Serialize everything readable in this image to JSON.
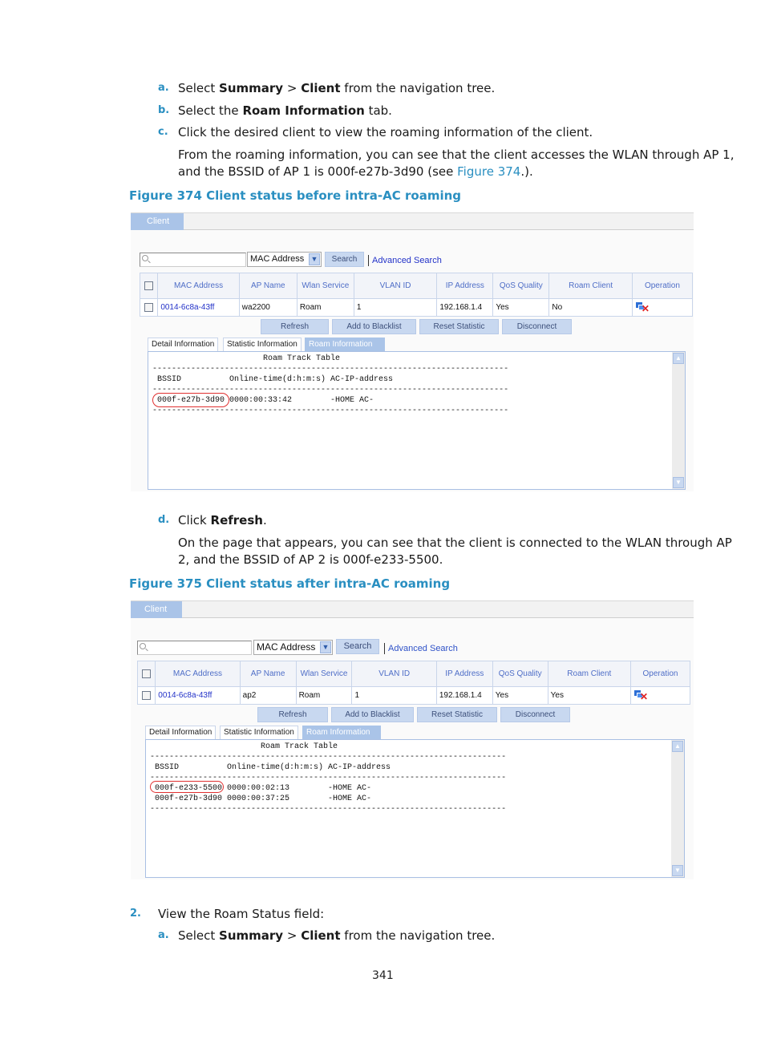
{
  "steps_top": [
    {
      "marker": "a.",
      "pre": "Select ",
      "b1": "Summary",
      "mid": " > ",
      "b2": "Client",
      "post": " from the navigation tree."
    },
    {
      "marker": "b.",
      "pre": "Select the ",
      "b1": "Roam Information",
      "post": " tab."
    },
    {
      "marker": "c.",
      "text": "Click the desired client to view the roaming information of the client."
    }
  ],
  "para1": {
    "line1": "From the roaming information, you can see that the client accesses the WLAN through AP 1,",
    "line2_pre": "and the BSSID of AP 1 is 000f-e27b-3d90 (see ",
    "line2_link": "Figure 374",
    "line2_post": ".)."
  },
  "figure374": {
    "caption": "Figure 374 Client status before intra-AC roaming",
    "tab_label": "Client",
    "search_placeholder": "",
    "select_value": "MAC Address",
    "search_button": "Search",
    "advanced_search": "Advanced Search",
    "columns": [
      "MAC Address",
      "AP Name",
      "Wlan Service",
      "VLAN ID",
      "IP Address",
      "QoS Quality",
      "Roam Client",
      "Operation"
    ],
    "row": {
      "mac": "0014-6c8a-43ff",
      "ap_name": "wa2200",
      "wlan_service": "Roam",
      "vlan_id": "1",
      "ip": "192.168.1.4",
      "qos": "Yes",
      "roam_client": "No"
    },
    "buttons": [
      "Refresh",
      "Add to Blacklist",
      "Reset Statistic",
      "Disconnect"
    ],
    "subtabs": [
      "Detail Information",
      "Statistic Information",
      "Roam Information"
    ],
    "roam_table": "                       Roam Track Table\n--------------------------------------------------------------------------\n BSSID          Online-time(d:h:m:s) AC-IP-address\n--------------------------------------------------------------------------\n 000f-e27b-3d90 0000:00:33:42        -HOME AC-\n--------------------------------------------------------------------------"
  },
  "step_d": {
    "marker": "d.",
    "pre": "Click ",
    "b1": "Refresh",
    "post": "."
  },
  "para2": {
    "line1": "On the page that appears, you can see that the client is connected to the WLAN through AP",
    "line2": "2, and the BSSID of AP 2 is 000f-e233-5500."
  },
  "figure375": {
    "caption": "Figure 375 Client status after intra-AC roaming",
    "tab_label": "Client",
    "select_value": "MAC Address",
    "search_button": "Search",
    "advanced_search": "Advanced Search",
    "columns": [
      "MAC Address",
      "AP Name",
      "Wlan Service",
      "VLAN ID",
      "IP Address",
      "QoS Quality",
      "Roam Client",
      "Operation"
    ],
    "row": {
      "mac": "0014-6c8a-43ff",
      "ap_name": "ap2",
      "wlan_service": "Roam",
      "vlan_id": "1",
      "ip": "192.168.1.4",
      "qos": "Yes",
      "roam_client": "Yes"
    },
    "buttons": [
      "Refresh",
      "Add to Blacklist",
      "Reset Statistic",
      "Disconnect"
    ],
    "subtabs": [
      "Detail Information",
      "Statistic Information",
      "Roam Information"
    ],
    "roam_table": "                       Roam Track Table\n--------------------------------------------------------------------------\n BSSID          Online-time(d:h:m:s) AC-IP-address\n--------------------------------------------------------------------------\n 000f-e233-5500 0000:00:02:13        -HOME AC-\n 000f-e27b-3d90 0000:00:37:25        -HOME AC-\n--------------------------------------------------------------------------"
  },
  "step2": {
    "marker": "2.",
    "text": "View the Roam Status field:"
  },
  "step2a": {
    "marker": "a.",
    "pre": "Select ",
    "b1": "Summary",
    "mid": " > ",
    "b2": "Client",
    "post": " from the navigation tree."
  },
  "page_number": "341"
}
